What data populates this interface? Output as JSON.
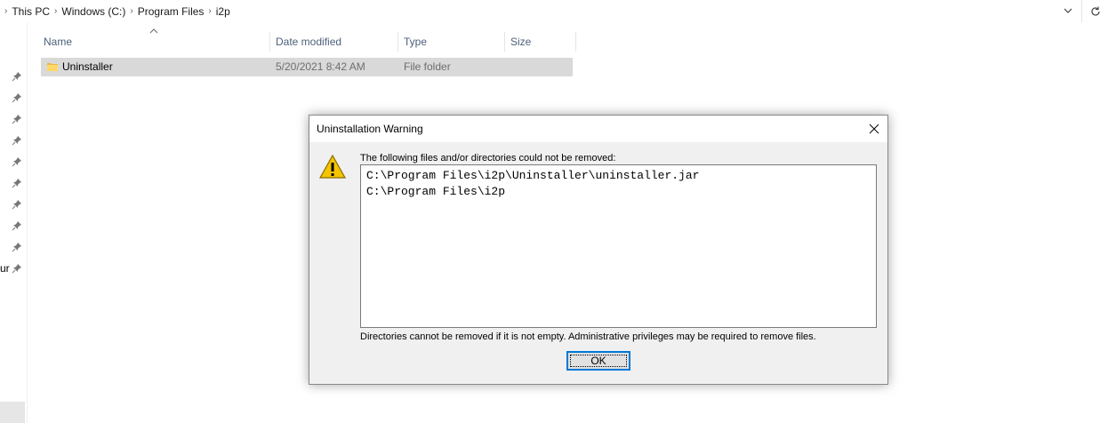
{
  "address_bar": {
    "crumbs": [
      "This PC",
      "Windows (C:)",
      "Program Files",
      "i2p"
    ]
  },
  "nav_pane": {
    "partial_label": "ur"
  },
  "file_list": {
    "columns": {
      "name": "Name",
      "date": "Date modified",
      "type": "Type",
      "size": "Size"
    },
    "rows": [
      {
        "name": "Uninstaller",
        "date": "5/20/2021 8:42 AM",
        "type": "File folder",
        "size": ""
      }
    ]
  },
  "dialog": {
    "title": "Uninstallation Warning",
    "message": "The following files and/or directories could not be removed:",
    "files": [
      "C:\\Program Files\\i2p\\Uninstaller\\uninstaller.jar",
      "C:\\Program Files\\i2p"
    ],
    "note": "Directories cannot be removed if it is not empty. Administrative privileges may be required to remove files.",
    "ok_label": "OK"
  },
  "colors": {
    "accent": "#0078d7",
    "selected_row": "#d9d9d9",
    "dialog_bg": "#f0f0f0",
    "header_text": "#4c607a"
  }
}
